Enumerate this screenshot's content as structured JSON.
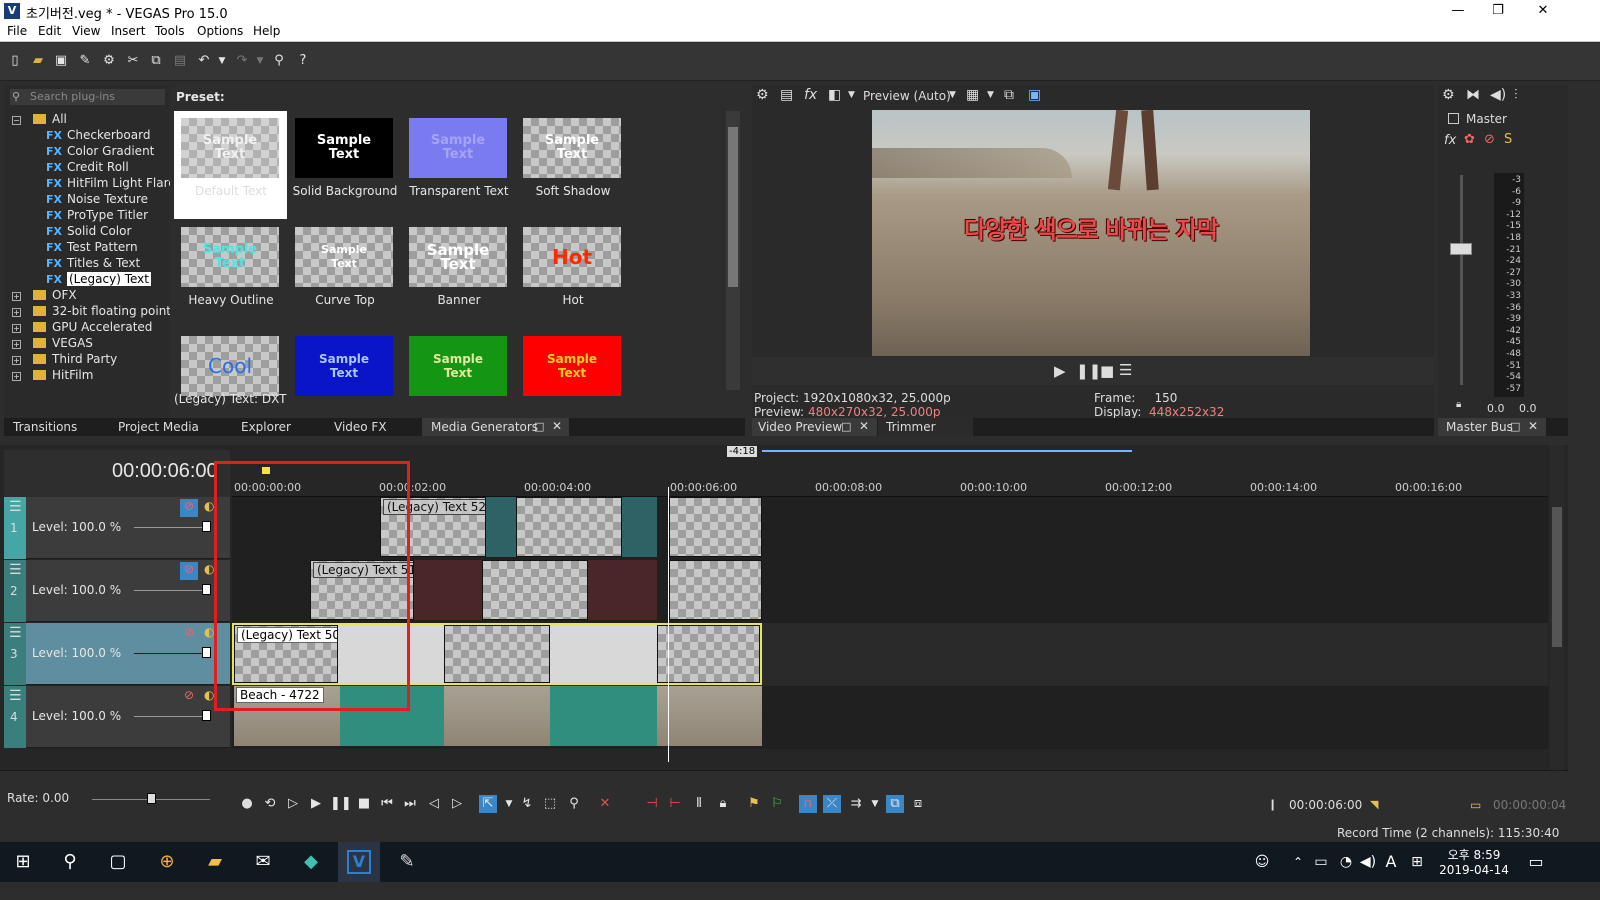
{
  "window": {
    "title": "초기버전.veg * - VEGAS Pro 15.0",
    "app_icon": "V",
    "minimize": "—",
    "maximize": "❐",
    "close": "✕"
  },
  "menu": [
    "File",
    "Edit",
    "View",
    "Insert",
    "Tools",
    "Options",
    "Help"
  ],
  "plugins": {
    "search_placeholder": "Search plug-ins",
    "root": "All",
    "fx_items": [
      "Checkerboard",
      "Color Gradient",
      "Credit Roll",
      "HitFilm Light Flares",
      "Noise Texture",
      "ProType Titler",
      "Solid Color",
      "Test Pattern",
      "Titles & Text",
      "(Legacy) Text"
    ],
    "fx_tag": "FX",
    "folders": [
      "OFX",
      "32-bit floating point",
      "GPU Accelerated",
      "VEGAS",
      "Third Party",
      "HitFilm"
    ]
  },
  "presets": {
    "header": "Preset:",
    "status": "(Legacy) Text: DXT",
    "items": [
      {
        "label": "Default Text",
        "thumb": "Sample\nText"
      },
      {
        "label": "Solid Background",
        "thumb": "Sample\nText"
      },
      {
        "label": "Transparent Text",
        "thumb": "Sample\nText"
      },
      {
        "label": "Soft Shadow",
        "thumb": "Sample\nText"
      },
      {
        "label": "Heavy Outline",
        "thumb": "Sample\nText"
      },
      {
        "label": "Curve Top",
        "thumb": "Sample\nText"
      },
      {
        "label": "Banner",
        "thumb": "Sample\nText"
      },
      {
        "label": "Hot",
        "thumb": "Hot"
      },
      {
        "label": "",
        "thumb": "Cool"
      },
      {
        "label": "",
        "thumb": "Sample\nText"
      },
      {
        "label": "",
        "thumb": "Sample\nText"
      },
      {
        "label": "",
        "thumb": "Sample\nText"
      }
    ]
  },
  "left_tabs": [
    "Transitions",
    "Project Media",
    "Explorer",
    "Video FX",
    "Media Generators"
  ],
  "preview": {
    "mode": "Preview (Auto)",
    "subtitle": "다양한 색으로 바뀌는 자막",
    "project_label": "Project:",
    "project_value": "1920x1080x32, 25.000p",
    "preview_label": "Preview:",
    "preview_value": "480x270x32, 25.000p",
    "frame_label": "Frame:",
    "frame_value": "150",
    "display_label": "Display:",
    "display_value": "448x252x32",
    "tabs": [
      "Video Preview",
      "Trimmer"
    ]
  },
  "master": {
    "label": "Master",
    "scale": [
      "3",
      "6",
      "9",
      "12",
      "15",
      "18",
      "21",
      "24",
      "27",
      "30",
      "33",
      "36",
      "39",
      "42",
      "45",
      "48",
      "51",
      "54",
      "57"
    ],
    "left_value": "0.0",
    "right_value": "0.0",
    "tab": "Master Bus"
  },
  "timeline": {
    "timecode": "00:00:06:00",
    "marker_badge": "-4:18",
    "ruler": [
      "00:00:00:00",
      "00:00:02:00",
      "00:00:04:00",
      "00:00:06:00",
      "00:00:08:00",
      "00:00:10:00",
      "00:00:12:00",
      "00:00:14:00",
      "00:00:16:00"
    ],
    "tracks": [
      {
        "num": "1",
        "level": "Level: 100.0 %"
      },
      {
        "num": "2",
        "level": "Level: 100.0 %"
      },
      {
        "num": "3",
        "level": "Level: 100.0 %"
      },
      {
        "num": "4",
        "level": "Level: 100.0 %"
      }
    ],
    "clips": {
      "t1": "(Legacy) Text 52",
      "t2": "(Legacy) Text 51",
      "t3": "(Legacy) Text 50",
      "t4": "Beach - 4722"
    },
    "rate": "Rate: 0.00"
  },
  "transport": {
    "cursor_time": "00:00:06:00",
    "length_time": "00:00:00:04"
  },
  "status": {
    "record_time": "Record Time (2 channels): 115:30:40"
  },
  "taskbar": {
    "time_line1": "오후 8:59",
    "time_line2": "2019-04-14",
    "ime": "A"
  },
  "colors": {
    "accent_cyan": "#46a6a6",
    "overlay_red": "#e02020",
    "preview_pink": "#f08080"
  }
}
